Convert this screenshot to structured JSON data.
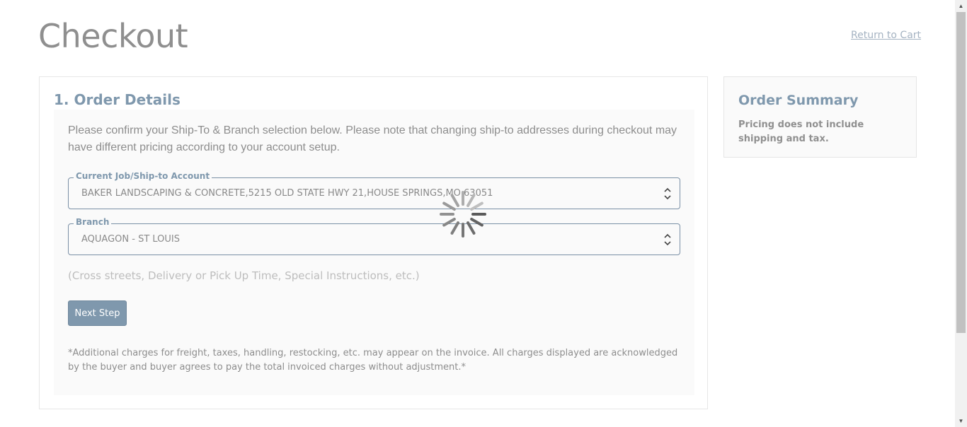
{
  "header": {
    "title": "Checkout",
    "return_link": "Return to Cart"
  },
  "order_details": {
    "title": "1. Order Details",
    "intro": "Please confirm your Ship-To & Branch selection below. Please note that changing ship-to addresses during checkout may have different pricing according to your account setup.",
    "ship_to": {
      "legend": "Current Job/Ship-to Account",
      "value": "BAKER LANDSCAPING & CONCRETE,5215 OLD STATE HWY 21,HOUSE SPRINGS,MO,63051"
    },
    "branch": {
      "legend": "Branch",
      "value": "AQUAGON - ST LOUIS"
    },
    "notes_placeholder": "(Cross streets, Delivery or Pick Up Time, Special Instructions, etc.)",
    "next_button": "Next Step",
    "disclaimer": "*Additional charges for freight, taxes, handling, restocking, etc. may appear on the invoice. All charges displayed are acknowledged by the buyer and buyer agrees to pay the total invoiced charges without adjustment.*"
  },
  "order_summary": {
    "title": "Order Summary",
    "note": "Pricing does not include shipping and tax."
  },
  "icons": {
    "select_arrows": "updown-chevron-icon",
    "loading": "spinner-icon"
  },
  "colors": {
    "accent": "#7f98ad",
    "field_border": "#7a90a6",
    "muted_text": "#8d8d8d",
    "link": "#a5b3c2"
  }
}
